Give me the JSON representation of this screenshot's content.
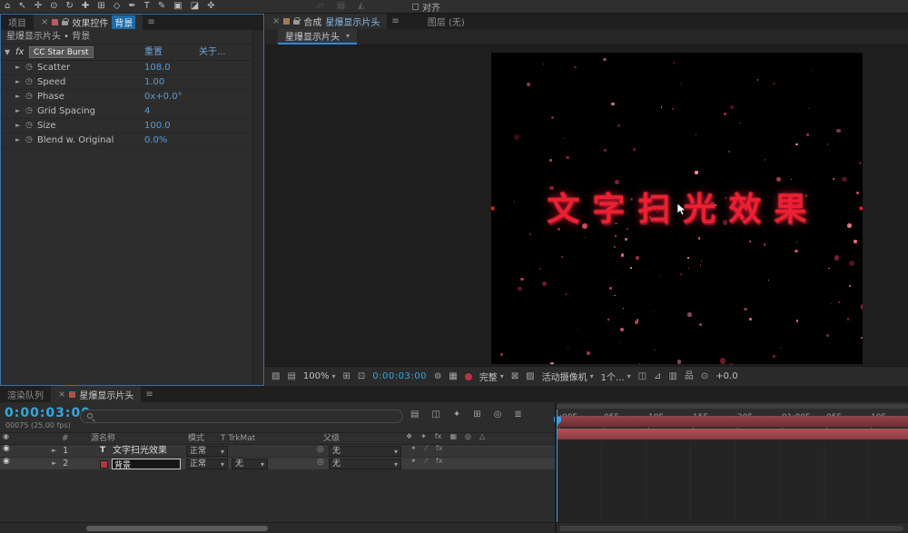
{
  "colors": {
    "accent_blue": "#3a6fa5",
    "value_blue": "#5a9bd3",
    "timecode_cyan": "#31a8e0",
    "title_red": "#ee1f32",
    "layer_bar_1": "#8d3c42",
    "layer_bar_2": "#a84b50"
  },
  "icons": {
    "menu": "≡",
    "close": "×",
    "dropdown": "▾",
    "expander_open": "▼",
    "expander_closed": "►",
    "stopwatch": "◷",
    "eye": "◉",
    "pickwhip": "◎",
    "fx_badge": "fx"
  },
  "top_toolbar": {
    "tools": [
      {
        "name": "home-icon",
        "glyph": "⌂"
      },
      {
        "name": "selection-tool",
        "glyph": "↖"
      },
      {
        "name": "hand-tool",
        "glyph": "✛"
      },
      {
        "name": "zoom-tool",
        "glyph": "⊙"
      },
      {
        "name": "rotation-tool",
        "glyph": "↻"
      },
      {
        "name": "camera-tool",
        "glyph": "✚"
      },
      {
        "name": "pan-behind-tool",
        "glyph": "⊞"
      },
      {
        "name": "shape-tool",
        "glyph": "◇"
      },
      {
        "name": "pen-tool",
        "glyph": "✒"
      },
      {
        "name": "type-tool",
        "glyph": "T"
      },
      {
        "name": "brush-tool",
        "glyph": "✎"
      },
      {
        "name": "clone-stamp-tool",
        "glyph": "▣"
      },
      {
        "name": "eraser-tool",
        "glyph": "◪"
      },
      {
        "name": "puppet-pin-tool",
        "glyph": "✜"
      }
    ],
    "dimmed_tools": [
      {
        "name": "dimmed-tool-icon-1",
        "glyph": "▱"
      },
      {
        "name": "dimmed-tool-icon-2",
        "glyph": "▤"
      },
      {
        "name": "dimmed-tool-icon-3",
        "glyph": "◭"
      }
    ],
    "align_label": "对齐"
  },
  "effect_panel": {
    "project_tab": "项目",
    "panel_title": "效果控件",
    "panel_target": "背景",
    "breadcrumb": "星爆显示片头 • 背景",
    "effect_name": "CC Star Burst",
    "reset_label": "重置",
    "about_label": "关于...",
    "properties": [
      {
        "name": "Scatter",
        "value": "108.0"
      },
      {
        "name": "Speed",
        "value": "1.00"
      },
      {
        "name": "Phase",
        "value": "0x+0.0°"
      },
      {
        "name": "Grid Spacing",
        "value": "4"
      },
      {
        "name": "Size",
        "value": "100.0"
      },
      {
        "name": "Blend w. Original",
        "value": "0.0%"
      }
    ]
  },
  "comp_panel": {
    "comp_label": "合成",
    "comp_name": "星爆显示片头",
    "layer_tab": "图层 (无)",
    "viewer_tab": "星爆显示片头",
    "viewport": {
      "title_text": "文字扫光效果",
      "particles": {
        "count": 175,
        "seed": 9,
        "palette": [
          "#c23a52",
          "#d94f66",
          "#a52940",
          "#e8697d",
          "#8f2136",
          "#f08a98"
        ]
      }
    },
    "toolbar": [
      {
        "name": "preview-monitor-icon",
        "type": "icon",
        "glyph": "▧"
      },
      {
        "name": "window-icon",
        "type": "icon",
        "glyph": "▤"
      },
      {
        "name": "magnification-select",
        "type": "select",
        "label": "100%"
      },
      {
        "name": "grid-guides-icon",
        "type": "icon",
        "glyph": "⊞"
      },
      {
        "name": "mask-visibility-icon",
        "type": "icon",
        "glyph": "⊡"
      },
      {
        "name": "preview-timecode",
        "type": "timecode",
        "label": "0:00:03:00"
      },
      {
        "name": "snapshot-icon",
        "type": "icon",
        "glyph": "⊚"
      },
      {
        "name": "show-snapshot-icon",
        "type": "icon",
        "glyph": "▦"
      },
      {
        "name": "channels-icon",
        "type": "swatch",
        "color": "#c03040"
      },
      {
        "name": "resolution-select",
        "type": "select",
        "label": "完整"
      },
      {
        "name": "roi-icon",
        "type": "icon",
        "glyph": "⊠"
      },
      {
        "name": "transparency-grid-icon",
        "type": "icon",
        "glyph": "▨"
      },
      {
        "name": "camera-select",
        "type": "select",
        "label": "活动摄像机"
      },
      {
        "name": "view-layout-select",
        "type": "select",
        "label": "1个..."
      },
      {
        "name": "pixel-aspect-icon",
        "type": "icon",
        "glyph": "◫"
      },
      {
        "name": "fast-previews-icon",
        "type": "icon",
        "glyph": "⊿"
      },
      {
        "name": "timeline-button-icon",
        "type": "icon",
        "glyph": "▥"
      },
      {
        "name": "comp-flow-icon",
        "type": "icon",
        "glyph": "品"
      },
      {
        "name": "reset-exposure-icon",
        "type": "icon",
        "glyph": "⊙"
      },
      {
        "name": "exposure-value",
        "type": "text",
        "label": "+0.0"
      }
    ]
  },
  "timeline": {
    "queue_tab": "渲染队列",
    "comp_tab": "星爆显示片头",
    "timecode": "0:00:03:00",
    "frame_info": "00075 (25.00 fps)",
    "search_placeholder": "",
    "toolbar_icons": [
      {
        "name": "comp-minimap-icon",
        "glyph": "▤"
      },
      {
        "name": "draft-3d-icon",
        "glyph": "◫"
      },
      {
        "name": "hide-shy-icon",
        "glyph": "✦"
      },
      {
        "name": "frame-blend-icon",
        "glyph": "⊞"
      },
      {
        "name": "motion-blur-icon",
        "glyph": "◎"
      },
      {
        "name": "graph-editor-icon",
        "glyph": "≣"
      }
    ],
    "columns": {
      "index": "#",
      "source": "源名称",
      "mode": "模式",
      "trkmat": "T TrkMat",
      "parent": "父级"
    },
    "switch_icons": [
      {
        "name": "shy-column-icon",
        "glyph": "❖"
      },
      {
        "name": "collapse-column-icon",
        "glyph": "✦"
      },
      {
        "name": "fx-column-icon",
        "glyph": "fx"
      },
      {
        "name": "frame-blend-column-icon",
        "glyph": "▦"
      },
      {
        "name": "motion-blur-column-icon",
        "glyph": "◎"
      },
      {
        "name": "threed-column-icon",
        "glyph": "△"
      }
    ],
    "row_switches": [
      {
        "name": "collapse-switch",
        "glyph": "✦"
      },
      {
        "name": "quality-switch",
        "glyph": "⁄"
      },
      {
        "name": "fx-switch",
        "glyph": "fx"
      }
    ],
    "layers": [
      {
        "index": "1",
        "thumb": "T",
        "name": "文字扫光效果",
        "mode": "正常",
        "trkmat": "",
        "parent": "无"
      },
      {
        "index": "2",
        "thumb": "",
        "name": "背景",
        "mode": "正常",
        "trkmat": "无",
        "parent": "无"
      }
    ],
    "ruler_ticks": [
      ":00F",
      "05F",
      "10F",
      "15F",
      "20F",
      "01:00F",
      "05F",
      "10F"
    ]
  }
}
